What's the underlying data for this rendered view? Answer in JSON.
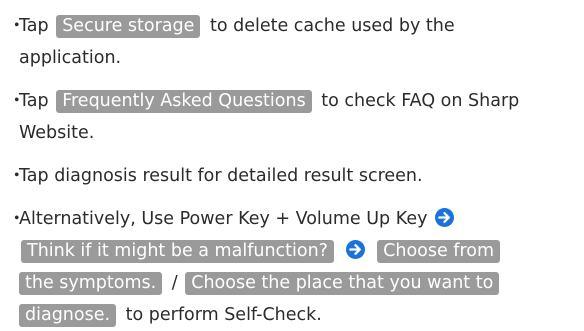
{
  "bullets": [
    {
      "lines": [
        [
          "Tap ",
          {
            "key": "Secure storage"
          },
          " to delete cache used by the"
        ],
        [
          "application."
        ]
      ]
    },
    {
      "lines": [
        [
          "Tap ",
          {
            "key": "Frequently Asked Questions"
          },
          " to check FAQ on Sharp"
        ],
        [
          "Website."
        ]
      ]
    },
    {
      "lines": [
        [
          "Tap diagnosis result for detailed result screen."
        ]
      ]
    },
    {
      "lines": [
        [
          "Alternatively, Use Power Key + Volume Up Key ",
          {
            "icon": "arrow-right-icon"
          }
        ],
        [
          {
            "key": "Think if it might be a malfunction?"
          },
          " ",
          {
            "icon": "arrow-right-icon"
          },
          " ",
          {
            "key": "Choose from"
          }
        ],
        [
          {
            "key": "the symptoms.",
            "cont": true
          },
          " / ",
          {
            "key": "Choose the place that you want to"
          }
        ],
        [
          {
            "key": "diagnose.",
            "cont": true
          },
          " to perform Self-Check."
        ]
      ]
    }
  ],
  "bullet_glyph": "・",
  "colors": {
    "text": "#2b2b2b",
    "key_bg": "#9a9a9a",
    "key_text": "#ffffff",
    "arrow": "#1a73d9"
  }
}
